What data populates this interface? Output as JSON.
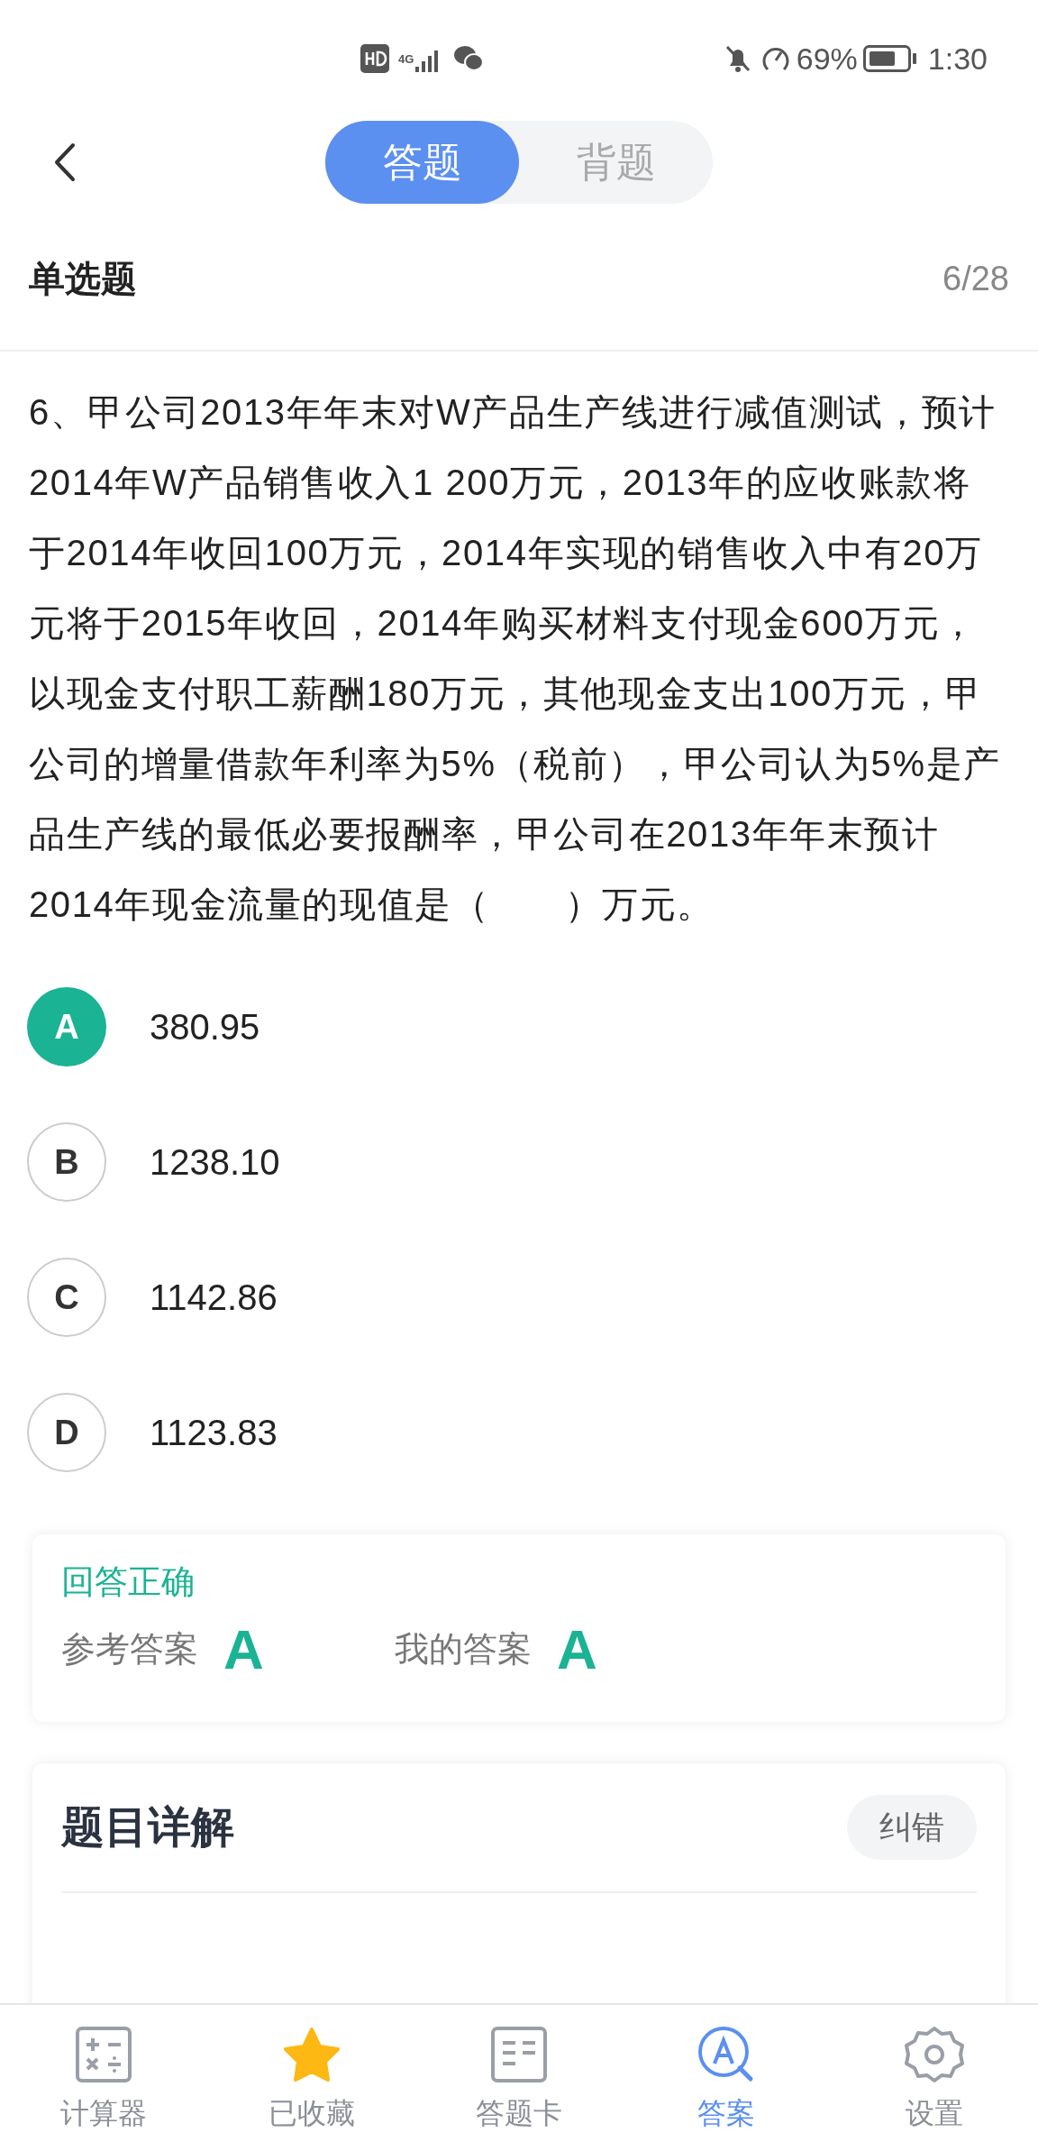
{
  "status_bar": {
    "network": "4G",
    "battery": "69%",
    "time": "1:30"
  },
  "tabs": [
    {
      "label": "答题",
      "selected": true
    },
    {
      "label": "背题",
      "selected": false
    }
  ],
  "question_header": {
    "type": "单选题",
    "progress": "6/28"
  },
  "question": "6、甲公司2013年年末对W产品生产线进行减值测试，预计2014年W产品销售收入1 200万元，2013年的应收账款将于2014年收回100万元，2014年实现的销售收入中有20万元将于2015年收回，2014年购买材料支付现金600万元，以现金支付职工薪酬180万元，其他现金支出100万元，甲公司的增量借款年利率为5%（税前），甲公司认为5%是产品生产线的最低必要报酬率，甲公司在2013年年末预计2014年现金流量的现值是（　　）万元。",
  "options": [
    {
      "letter": "A",
      "text": "380.95",
      "selected": true
    },
    {
      "letter": "B",
      "text": "1238.10",
      "selected": false
    },
    {
      "letter": "C",
      "text": "1142.86",
      "selected": false
    },
    {
      "letter": "D",
      "text": "1123.83",
      "selected": false
    }
  ],
  "result": {
    "verdict": "回答正确",
    "reference_label": "参考答案",
    "reference_answer": "A",
    "my_label": "我的答案",
    "my_answer": "A"
  },
  "explanation": {
    "title": "题目详解",
    "report_button": "纠错"
  },
  "bottom_nav": [
    {
      "kind": "calculator",
      "label": "计算器",
      "selected": false
    },
    {
      "kind": "star",
      "label": "已收藏",
      "selected": false
    },
    {
      "kind": "card",
      "label": "答题卡",
      "selected": false
    },
    {
      "kind": "answer",
      "label": "答案",
      "selected": true
    },
    {
      "kind": "settings",
      "label": "设置",
      "selected": false
    }
  ]
}
